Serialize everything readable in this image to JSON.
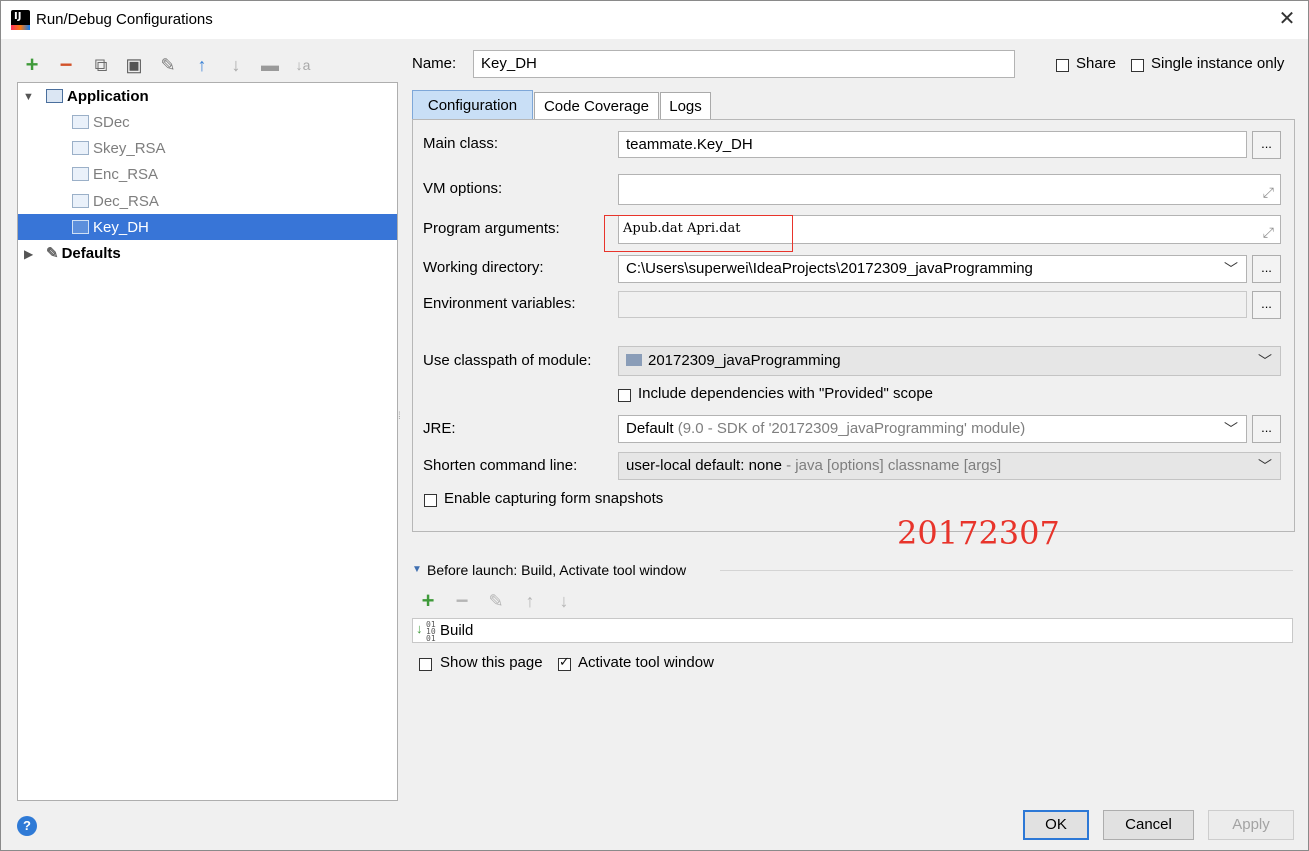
{
  "window": {
    "title": "Run/Debug Configurations",
    "close_glyph": "✕"
  },
  "toolbar": {
    "add": "+",
    "remove": "−",
    "copy": "⧉",
    "save": "▣",
    "wrench": "✎",
    "up": "↑",
    "down": "↓",
    "folder": "▬",
    "sort": "↓a"
  },
  "tree": {
    "application_label": "Application",
    "items": [
      {
        "label": "SDec"
      },
      {
        "label": "Skey_RSA"
      },
      {
        "label": "Enc_RSA"
      },
      {
        "label": "Dec_RSA"
      },
      {
        "label": "Key_DH"
      }
    ],
    "defaults_label": "Defaults"
  },
  "form": {
    "name_label": "Name:",
    "name_value": "Key_DH",
    "share_label": "Share",
    "single_instance_label": "Single instance only",
    "tabs": [
      "Configuration",
      "Code Coverage",
      "Logs"
    ],
    "main_class_label": "Main class:",
    "main_class_value": "teammate.Key_DH",
    "vm_options_label": "VM options:",
    "vm_options_value": "",
    "program_args_label": "Program arguments:",
    "program_args_value": "Apub.dat Apri.dat",
    "working_dir_label": "Working directory:",
    "working_dir_value": "C:\\Users\\superwei\\IdeaProjects\\20172309_javaProgramming",
    "env_vars_label": "Environment variables:",
    "env_vars_value": "",
    "classpath_label": "Use classpath of module:",
    "classpath_value": "20172309_javaProgramming",
    "include_deps_label": "Include dependencies with \"Provided\" scope",
    "jre_label": "JRE:",
    "jre_value": "Default",
    "jre_hint": "(9.0 - SDK of '20172309_javaProgramming' module)",
    "shorten_label": "Shorten command line:",
    "shorten_value": "user-local default: none",
    "shorten_hint": "- java [options] classname [args]",
    "enable_snapshots_label": "Enable capturing form snapshots",
    "dots": "..."
  },
  "annotation": {
    "watermark_text": "20172307",
    "highlight_color": "#e8342b"
  },
  "before_launch": {
    "header": "Before launch: Build, Activate tool window",
    "build_label": "Build",
    "show_page_label": "Show this page",
    "activate_tool_label": "Activate tool window"
  },
  "buttons": {
    "help": "?",
    "ok": "OK",
    "cancel": "Cancel",
    "apply": "Apply"
  }
}
